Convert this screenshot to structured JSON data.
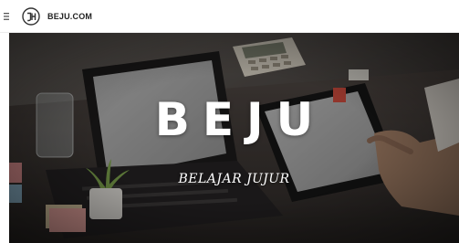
{
  "header": {
    "site_name": "BEJU.COM",
    "logo_icon": "beju-logo-icon",
    "menu_icon": "hamburger-menu-icon"
  },
  "hero": {
    "title": "BEJU",
    "subtitle": "BELAJAR JUJUR"
  },
  "colors": {
    "header_bg": "#ffffff",
    "hero_overlay": "#3a3634",
    "hero_text": "#ffffff"
  }
}
